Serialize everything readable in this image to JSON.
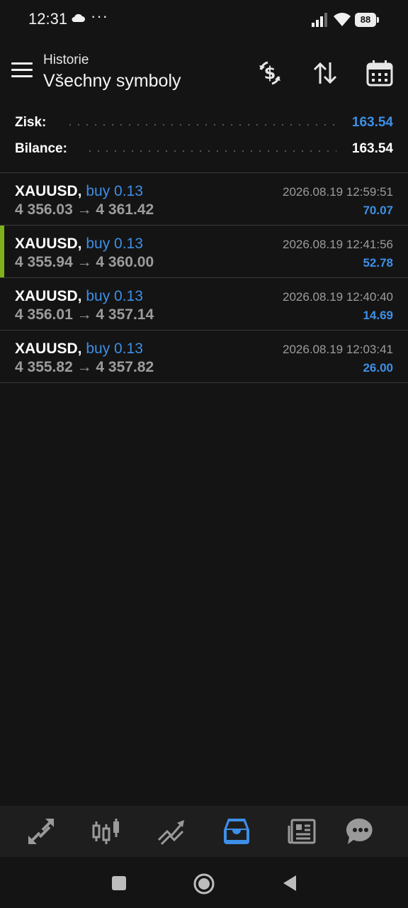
{
  "status_bar": {
    "time": "12:31",
    "cloud_icon": "cloud-icon",
    "more_indicator": "···",
    "battery": "88"
  },
  "header": {
    "subtitle": "Historie",
    "title": "Všechny symboly",
    "actions": [
      "currency-exchange-icon",
      "sort-icon",
      "calendar-icon"
    ]
  },
  "summary": {
    "profit_label": "Zisk:",
    "profit_value": "163.54",
    "balance_label": "Bilance:",
    "balance_value": "163.54"
  },
  "deals": [
    {
      "symbol": "XAUUSD,",
      "type": " buy 0.13",
      "prices": "4 356.03 → 4 361.42",
      "time": "2026.08.19 12:59:51",
      "profit": "70.07"
    },
    {
      "symbol": "XAUUSD,",
      "type": " buy 0.13",
      "prices": "4 355.94 → 4 360.00",
      "time": "2026.08.19 12:41:56",
      "profit": "52.78",
      "selected": true
    },
    {
      "symbol": "XAUUSD,",
      "type": " buy 0.13",
      "prices": "4 356.01 → 4 357.14",
      "time": "2026.08.19 12:40:40",
      "profit": "14.69"
    },
    {
      "symbol": "XAUUSD,",
      "type": " buy 0.13",
      "prices": "4 355.82 → 4 357.82",
      "time": "2026.08.19 12:03:41",
      "profit": "26.00"
    }
  ],
  "bottom_nav": {
    "items": [
      "quotes-icon",
      "chart-icon",
      "trade-icon",
      "history-icon",
      "news-icon",
      "chat-icon"
    ],
    "active": "history-icon"
  },
  "colors": {
    "background": "#141414",
    "accent_blue": "#3d8fe6",
    "selection_marker": "#7fb21a",
    "secondary_text": "#9c9c9c"
  }
}
